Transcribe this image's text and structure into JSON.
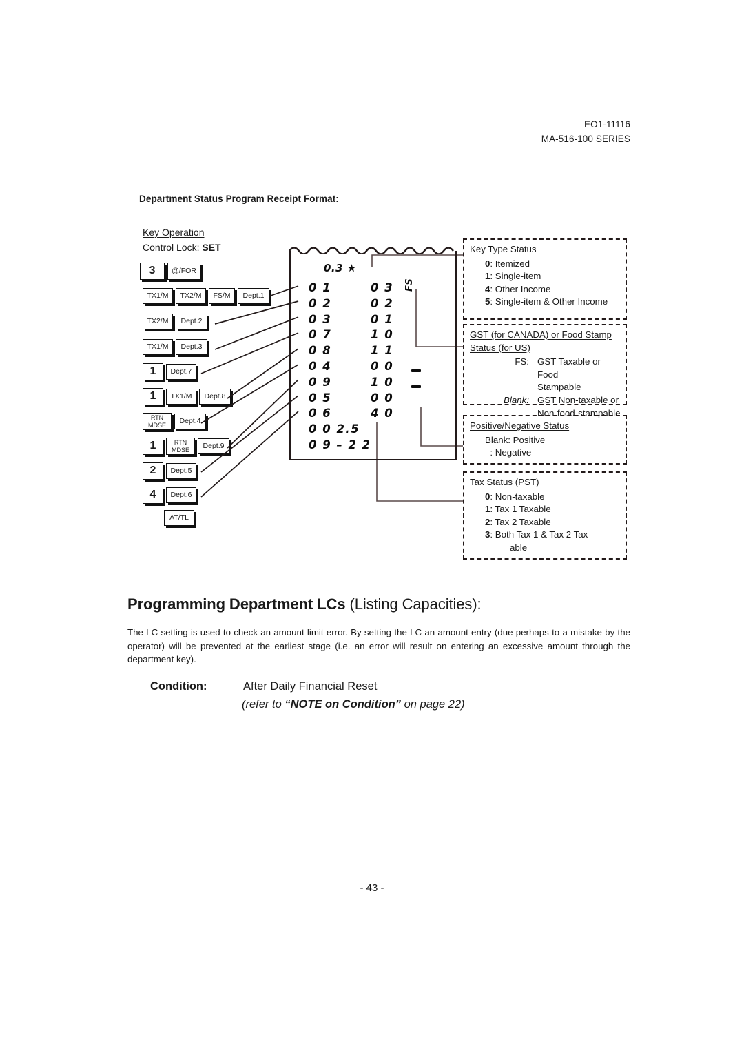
{
  "header": {
    "doc_code": "EO1-11116",
    "series": "MA-516-100 SERIES"
  },
  "section": {
    "title": "Department Status Program Receipt Format:"
  },
  "key_operation": {
    "label": "Key Operation",
    "control_lock_prefix": "Control Lock: ",
    "control_lock_value": "SET",
    "rows": [
      {
        "keys": [
          {
            "label": "3",
            "type": "num"
          },
          {
            "label": "@/FOR",
            "type": "text"
          }
        ]
      },
      {
        "keys": [
          {
            "label": "TX1/M",
            "type": "text"
          },
          {
            "label": "TX2/M",
            "type": "text"
          },
          {
            "label": "FS/M",
            "type": "text"
          },
          {
            "label": "Dept.1",
            "type": "text"
          }
        ]
      },
      {
        "keys": [
          {
            "label": "TX2/M",
            "type": "text"
          },
          {
            "label": "Dept.2",
            "type": "text"
          }
        ]
      },
      {
        "keys": [
          {
            "label": "TX1/M",
            "type": "text"
          },
          {
            "label": "Dept.3",
            "type": "text"
          }
        ]
      },
      {
        "keys": [
          {
            "label": "1",
            "type": "num"
          },
          {
            "label": "Dept.7",
            "type": "text"
          }
        ]
      },
      {
        "keys": [
          {
            "label": "1",
            "type": "num"
          },
          {
            "label": "TX1/M",
            "type": "text"
          },
          {
            "label": "Dept.8",
            "type": "text"
          }
        ]
      },
      {
        "keys": [
          {
            "label": "RTN\nMDSE",
            "type": "two"
          },
          {
            "label": "Dept.4",
            "type": "text"
          }
        ]
      },
      {
        "keys": [
          {
            "label": "1",
            "type": "num"
          },
          {
            "label": "RTN\nMDSE",
            "type": "two"
          },
          {
            "label": "Dept.9",
            "type": "text"
          }
        ]
      },
      {
        "keys": [
          {
            "label": "2",
            "type": "num"
          },
          {
            "label": "Dept.5",
            "type": "text"
          }
        ]
      },
      {
        "keys": [
          {
            "label": "4",
            "type": "num"
          },
          {
            "label": "Dept.6",
            "type": "text"
          }
        ]
      },
      {
        "keys": [
          {
            "label": "AT/TL",
            "type": "text"
          }
        ]
      }
    ]
  },
  "receipt": {
    "header_line": "0.3 ★",
    "lines": [
      {
        "left": "0 1",
        "right": "0 3"
      },
      {
        "left": "0 2",
        "right": "0 2"
      },
      {
        "left": "0 3",
        "right": "0 1"
      },
      {
        "left": "0 7",
        "right": "1 0"
      },
      {
        "left": "0 8",
        "right": "1 1"
      },
      {
        "left": "0 4",
        "right": "0 0"
      },
      {
        "left": "0 9",
        "right": "1 0"
      },
      {
        "left": "0 5",
        "right": "0 0"
      },
      {
        "left": "0 6",
        "right": "4 0"
      }
    ],
    "footer_lines": [
      "0 0 2.5",
      "0 9 – 2 2"
    ],
    "fs_marker": "FS"
  },
  "annotations": {
    "key_type_status": {
      "title": "Key Type Status",
      "items": [
        {
          "code": "0",
          "desc": ": Itemized"
        },
        {
          "code": "1",
          "desc": ": Single-item"
        },
        {
          "code": "4",
          "desc": ": Other Income"
        },
        {
          "code": "5",
          "desc": ": Single-item & Other Income"
        }
      ]
    },
    "gst_status": {
      "title_line1": "GST (for CANADA) or Food Stamp",
      "title_line2": "Status (for US)",
      "rows": [
        {
          "key": "FS:",
          "italic": false,
          "value": "GST Taxable or Food",
          "cont": "Stampable"
        },
        {
          "key": "Blank:",
          "italic": true,
          "value": "GST Non-taxable or",
          "cont": "Non-food-stampable"
        }
      ]
    },
    "posneg_status": {
      "title": "Positive/Negative Status",
      "items": [
        {
          "code": "",
          "desc": "Blank: Positive"
        },
        {
          "code": "",
          "desc": "–: Negative"
        }
      ]
    },
    "tax_status": {
      "title": "Tax Status (PST)",
      "items": [
        {
          "code": "0",
          "desc": ": Non-taxable"
        },
        {
          "code": "1",
          "desc": ": Tax 1 Taxable"
        },
        {
          "code": "2",
          "desc": ": Tax 2 Taxable"
        },
        {
          "code": "3",
          "desc": ": Both Tax 1 & Tax 2 Tax-"
        }
      ],
      "item_continuation": "able"
    }
  },
  "main": {
    "heading_bold": "Programming Department LCs",
    "heading_rest": " (Listing Capacities):",
    "paragraph": "The LC setting is used to check an amount limit error. By setting the LC an amount entry (due perhaps to a mistake by the operator) will be prevented at the earliest stage (i.e. an error will result on entering an excessive amount through the department key).",
    "condition_label": "Condition:",
    "condition_value": "After Daily Financial Reset",
    "condition_note_pre": "(refer to ",
    "condition_note_bold": "“NOTE on Condition”",
    "condition_note_post": " on page 22)"
  },
  "footer": {
    "page_number": "- 43 -"
  }
}
